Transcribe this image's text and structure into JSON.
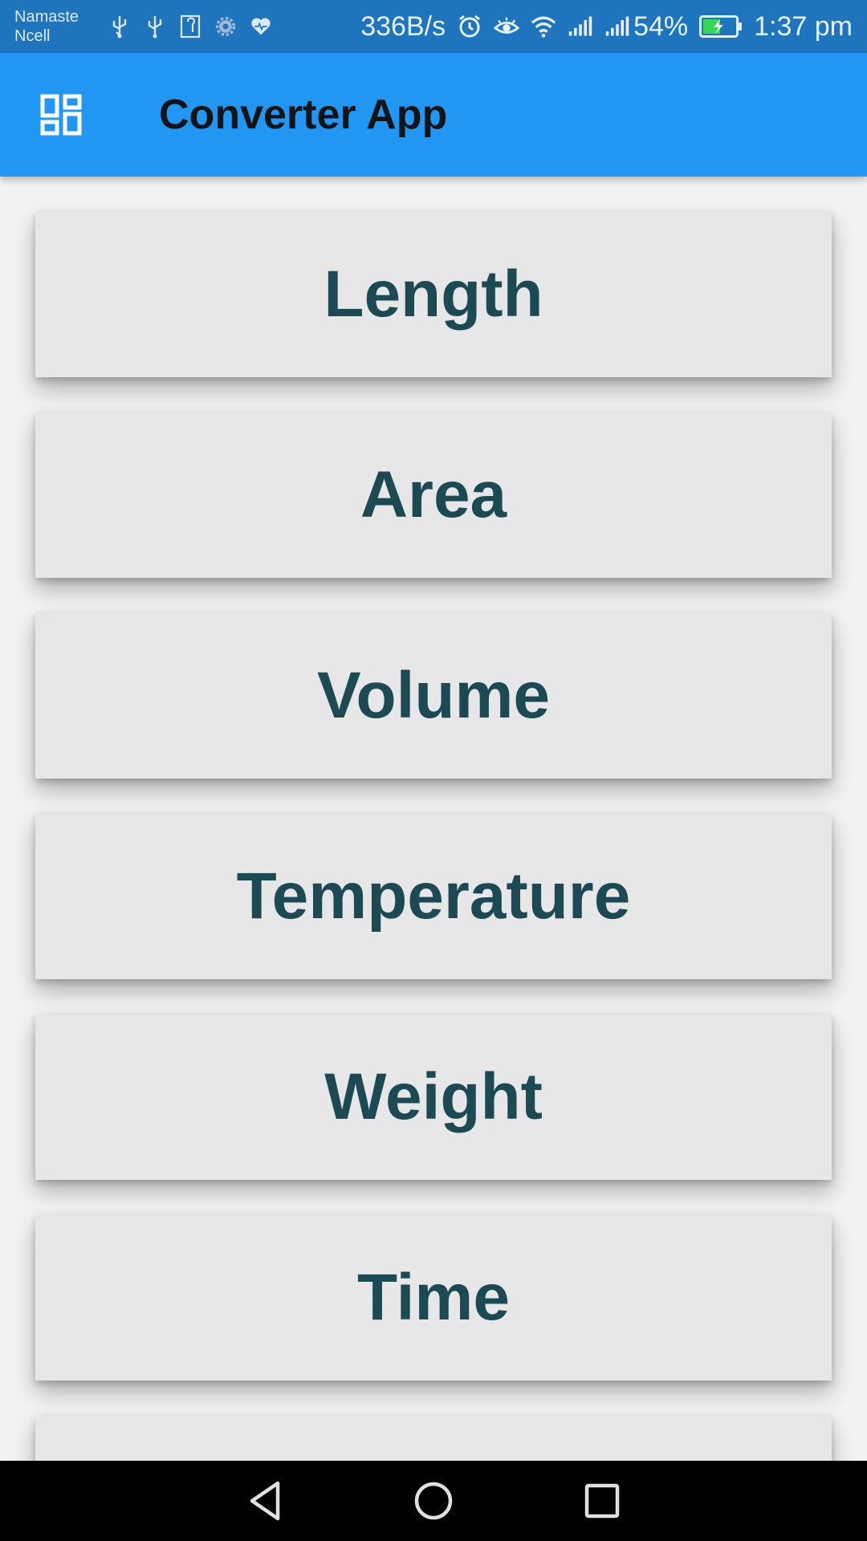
{
  "status_bar": {
    "carrier_line1": "Namaste",
    "carrier_line2": "Ncell",
    "left_icons": [
      "usb-icon",
      "usb-icon",
      "sim-icon",
      "settings-icon",
      "health-icon"
    ],
    "speed": "336B/s",
    "right_icons": [
      "alarm-icon",
      "eye-icon",
      "wifi-icon",
      "signal-icon",
      "signal-icon"
    ],
    "battery_percent": "54%",
    "battery_level": 0.54,
    "time": "1:37 pm"
  },
  "app_bar": {
    "menu_icon": "dashboard-icon",
    "title": "Converter App"
  },
  "categories": [
    {
      "label": "Length"
    },
    {
      "label": "Area"
    },
    {
      "label": "Volume"
    },
    {
      "label": "Temperature"
    },
    {
      "label": "Weight"
    },
    {
      "label": "Time"
    },
    {
      "label": ""
    }
  ],
  "nav_bar": {
    "back_icon": "back-triangle-icon",
    "home_icon": "home-circle-icon",
    "recents_icon": "recents-square-icon"
  },
  "colors": {
    "status_bar_bg": "#1e74bd",
    "app_bar_bg": "#2196f3",
    "card_bg": "#e7e7e7",
    "card_text": "#1b4a55",
    "nav_bar_bg": "#000000"
  }
}
